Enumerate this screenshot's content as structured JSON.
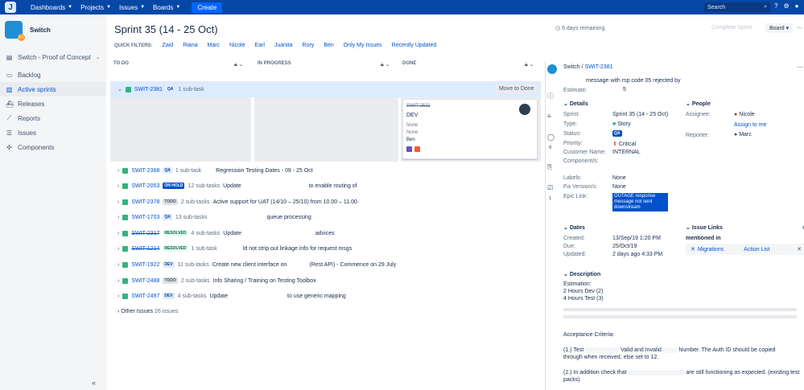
{
  "topnav": {
    "items": [
      "Dashboards",
      "Projects",
      "Issues",
      "Boards"
    ],
    "create": "Create",
    "search_placeholder": "Search"
  },
  "sidebar": {
    "project_name": "Switch",
    "badge": "RT",
    "project_type": "Switch - Proof of Concept",
    "items": [
      "Backlog",
      "Active sprints",
      "Releases",
      "Reports",
      "Issues",
      "Components"
    ]
  },
  "board": {
    "title": "Sprint 35 (14 - 25 Oct)",
    "quick_filters_label": "QUICK FILTERS:",
    "filters": [
      "Zaid",
      "Riana",
      "Marc",
      "Nicole",
      "Earl",
      "Juanita",
      "Rory",
      "Ben",
      "Only My Issues",
      "Recently Updated"
    ],
    "remaining": "6 days remaining",
    "complete_sprint": "Complete Sprint",
    "board_button": "Board",
    "columns": [
      "TO DO",
      "IN PROGRESS",
      "DONE"
    ],
    "move_to_done": "Move to Done",
    "other_issues": "Other Issues",
    "other_count": "26 issues"
  },
  "rows": [
    {
      "key": "SWIT-2381",
      "label": "QA",
      "subs": "1 sub-task",
      "summary": "",
      "strike": false
    },
    {
      "key": "SWIT-2368",
      "label": "QA",
      "subs": "1 sub-task",
      "summary": "Regression Testing Dates - 09 - 25 Oct",
      "strike": false
    },
    {
      "key": "SWIT-2053",
      "label": "ON HOLD",
      "subs": "12 sub-tasks",
      "summary": "Update",
      "summary2": "to enable routing of",
      "strike": false
    },
    {
      "key": "SWIT-2378",
      "label": "TODO",
      "subs": "2 sub-tasks",
      "summary": "Active support for UAT (14/10 – 25/10) from 10.00 – 11.00",
      "strike": false
    },
    {
      "key": "SWIT-1703",
      "label": "QA",
      "subs": "13 sub-tasks",
      "summary": "queue processing",
      "strike": false
    },
    {
      "key": "SWIT-2317",
      "label": "RESOLVED",
      "subs": "4 sub-tasks",
      "summary": "Update",
      "summary2": "advices",
      "strike": true
    },
    {
      "key": "SWIT-1214",
      "label": "RESOLVED",
      "subs": "1 sub-task",
      "summary": "ld not strip out linkage info for request msgs",
      "strike": true
    },
    {
      "key": "SWIT-1922",
      "label": "DEV",
      "subs": "11 sub-tasks",
      "summary": "Create new client interface on",
      "summary2": "(Rest API) - Commence on 29 July",
      "strike": false
    },
    {
      "key": "SWIT-2488",
      "label": "TODO",
      "subs": "2 sub-tasks",
      "summary": "Info Sharing / Training on Testing Toolbox",
      "strike": false
    },
    {
      "key": "SWIT-2497",
      "label": "DEV",
      "subs": "4 sub-tasks",
      "summary": "Update",
      "summary2": "to use generic mapping",
      "strike": false
    }
  ],
  "card": {
    "key": "SWIT-2511",
    "status": "DEV",
    "none1": "None",
    "none2": "None",
    "assignee": "Ben"
  },
  "detail": {
    "project": "Switch",
    "key": "SWIT-2381",
    "summary": "message with rsp code 05 rejected by",
    "estimate_label": "Estimate:",
    "estimate": "5",
    "details_title": "Details",
    "people_title": "People",
    "sprint_l": "Sprint:",
    "sprint": "Sprint 35 (14 - 25 Oct)",
    "type_l": "Type:",
    "type": "Story",
    "status_l": "Status:",
    "status": "QA",
    "priority_l": "Priority:",
    "priority": "Critical",
    "customer_l": "Customer Name:",
    "customer": "INTERNAL",
    "components_l": "Component/s:",
    "labels_l": "Labels:",
    "labels": "None",
    "fix_l": "Fix Version/s:",
    "fix": "None",
    "epic_l": "Epic Link:",
    "epic": "OUTAGE response message not sent downstream",
    "assignee_l": "Assignee:",
    "assignee": "Nicole",
    "assign_me": "Assign to me",
    "reporter_l": "Reporter:",
    "reporter": "Marc",
    "dates_title": "Dates",
    "created_l": "Created:",
    "created": "13/Sep/19 1:20 PM",
    "due_l": "Due:",
    "due": "25/Oct/19",
    "updated_l": "Updated:",
    "updated": "2 days ago 4:33 PM",
    "links_title": "Issue Links",
    "mentioned": "mentioned in",
    "link1": "Migrations",
    "link2": "Action List",
    "desc_title": "Description",
    "desc_est": "Estimation:",
    "desc_dev": "2 Hours Dev (2)",
    "desc_test": "4 Hours Test (3)",
    "acceptance": "Acceptance Criteria:",
    "ac1": "(1.) Test",
    "ac1b": "Valid and Invalid",
    "ac1c": "Number. The Auth ID should be copied",
    "ac1d": "through when received, else set to 12.",
    "ac2": "(2.) In addition check that",
    "ac2b": "are still functioning as expected. (existing test",
    "ac2c": "packs)",
    "count_comments": "8",
    "count_sub": "1"
  }
}
